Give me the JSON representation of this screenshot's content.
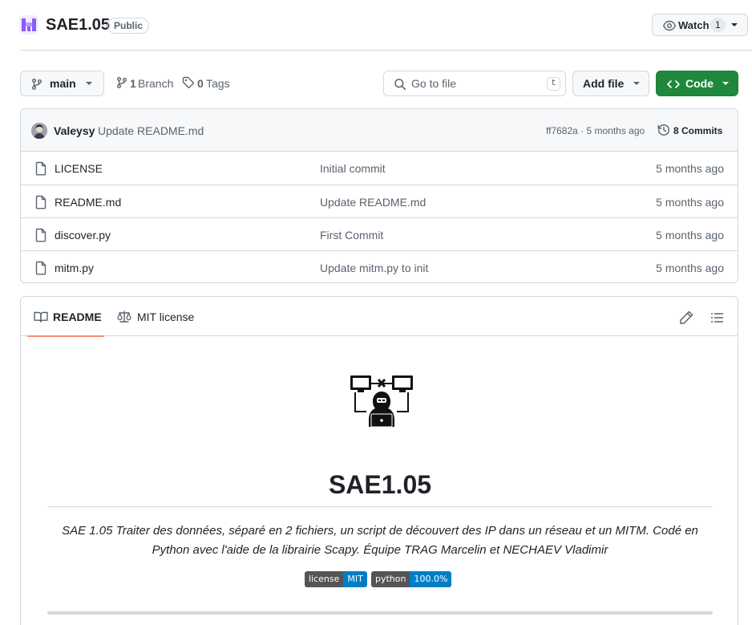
{
  "repo": {
    "name": "SAE1.05",
    "visibility": "Public",
    "watch_label": "Watch",
    "watch_count": "1"
  },
  "toolbar": {
    "branch": "main",
    "branch_count": "1",
    "branch_label": "Branch",
    "tag_count": "0",
    "tag_label": "Tags",
    "search_placeholder": "Go to file",
    "search_shortcut": "t",
    "add_file_label": "Add file",
    "code_label": "Code"
  },
  "latest_commit": {
    "author": "Valeysy",
    "message": "Update README.md",
    "meta": "ff7682a · 5 months ago",
    "commits_label": "8 Commits"
  },
  "files": [
    {
      "name": "LICENSE",
      "message": "Initial commit",
      "date": "5 months ago"
    },
    {
      "name": "README.md",
      "message": "Update README.md",
      "date": "5 months ago"
    },
    {
      "name": "discover.py",
      "message": "First Commit",
      "date": "5 months ago"
    },
    {
      "name": "mitm.py",
      "message": "Update mitm.py to init",
      "date": "5 months ago"
    }
  ],
  "readme": {
    "tab_readme": "README",
    "tab_license": "MIT license",
    "title": "SAE1.05",
    "description": "SAE 1.05 Traiter des données, séparé en 2 fichiers, un script de découvert des IP dans un réseau et un MITM. Codé en Python avec l'aide de la librairie Scapy. Équipe TRAG Marcelin et NECHAEV Vladimir",
    "badges": [
      {
        "left": "license",
        "right": "MIT"
      },
      {
        "left": "python",
        "right": "100.0%"
      }
    ]
  },
  "colors": {
    "accent_green": "#1f883d",
    "tab_underline": "#fd8c73",
    "badge_blue": "#007ec6",
    "border": "#d1d9e0"
  }
}
